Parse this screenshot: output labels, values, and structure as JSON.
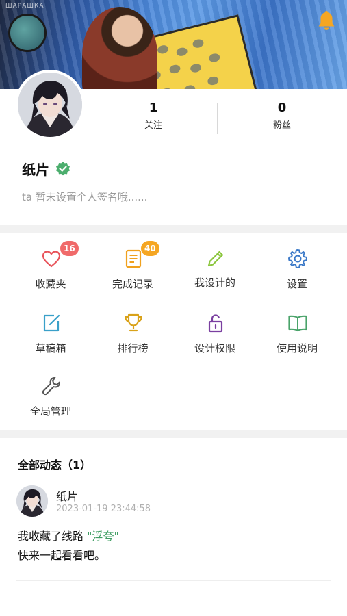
{
  "banner": {
    "caption": "ШАРАШКА"
  },
  "profile": {
    "following_count": "1",
    "following_label": "关注",
    "followers_count": "0",
    "followers_label": "粉丝",
    "username": "纸片",
    "signature": "ta 暂未设置个人签名哦......"
  },
  "menu": {
    "favorites": {
      "label": "收藏夹",
      "badge": "16"
    },
    "records": {
      "label": "完成记录",
      "badge": "40"
    },
    "my_designs": {
      "label": "我设计的"
    },
    "settings": {
      "label": "设置"
    },
    "drafts": {
      "label": "草稿箱"
    },
    "leaderboard": {
      "label": "排行榜"
    },
    "design_permission": {
      "label": "设计权限"
    },
    "guide": {
      "label": "使用说明"
    },
    "global_admin": {
      "label": "全局管理"
    }
  },
  "activity": {
    "title": "全部动态（1）",
    "items": [
      {
        "name": "纸片",
        "time": "2023-01-19 23:44:58",
        "text_prefix": "我收藏了线路 ",
        "link": "\"浮夸\"",
        "text_line2": "快来一起看看吧。"
      }
    ]
  },
  "colors": {
    "bell": "#f5a623",
    "heart": "#e8535a",
    "record": "#f0a11e",
    "pencil": "#8cc63f",
    "gear": "#3b79c8",
    "edit": "#3aa0c9",
    "trophy": "#d9a21a",
    "lock": "#7a3fa0",
    "book": "#4aa36a",
    "wrench": "#555555",
    "badge_red": "#f06a6a",
    "badge_orange": "#f5a623",
    "verify": "#4cae6e",
    "link": "#3f9d62"
  }
}
